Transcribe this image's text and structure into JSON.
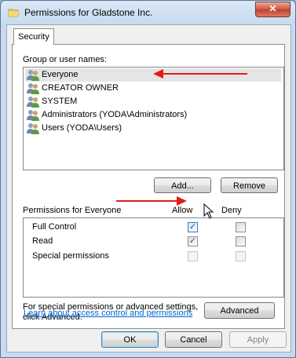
{
  "window": {
    "title": "Permissions for Gladstone Inc.",
    "close_glyph": "✕"
  },
  "tab": {
    "label": "Security"
  },
  "groups": {
    "label": "Group or user names:",
    "items": [
      {
        "name": "Everyone",
        "selected": true
      },
      {
        "name": "CREATOR OWNER"
      },
      {
        "name": "SYSTEM"
      },
      {
        "name": "Administrators (YODA\\Administrators)"
      },
      {
        "name": "Users (YODA\\Users)"
      }
    ],
    "add_label": "Add...",
    "remove_label": "Remove"
  },
  "permissions": {
    "label": "Permissions for Everyone",
    "allow_header": "Allow",
    "deny_header": "Deny",
    "rows": [
      {
        "name": "Full Control",
        "allow": true,
        "deny": false
      },
      {
        "name": "Read",
        "allow": true,
        "deny": false
      },
      {
        "name": "Special permissions",
        "allow": false,
        "deny": false
      }
    ]
  },
  "advanced": {
    "note_line1": "For special permissions or advanced settings,",
    "note_line2": "click Advanced.",
    "button_label": "Advanced"
  },
  "learn_link": "Learn about access control and permissions",
  "footer": {
    "ok_label": "OK",
    "cancel_label": "Cancel",
    "apply_label": "Apply"
  },
  "colors": {
    "annotation_arrow": "#e31b1b",
    "link": "#0066cc"
  }
}
